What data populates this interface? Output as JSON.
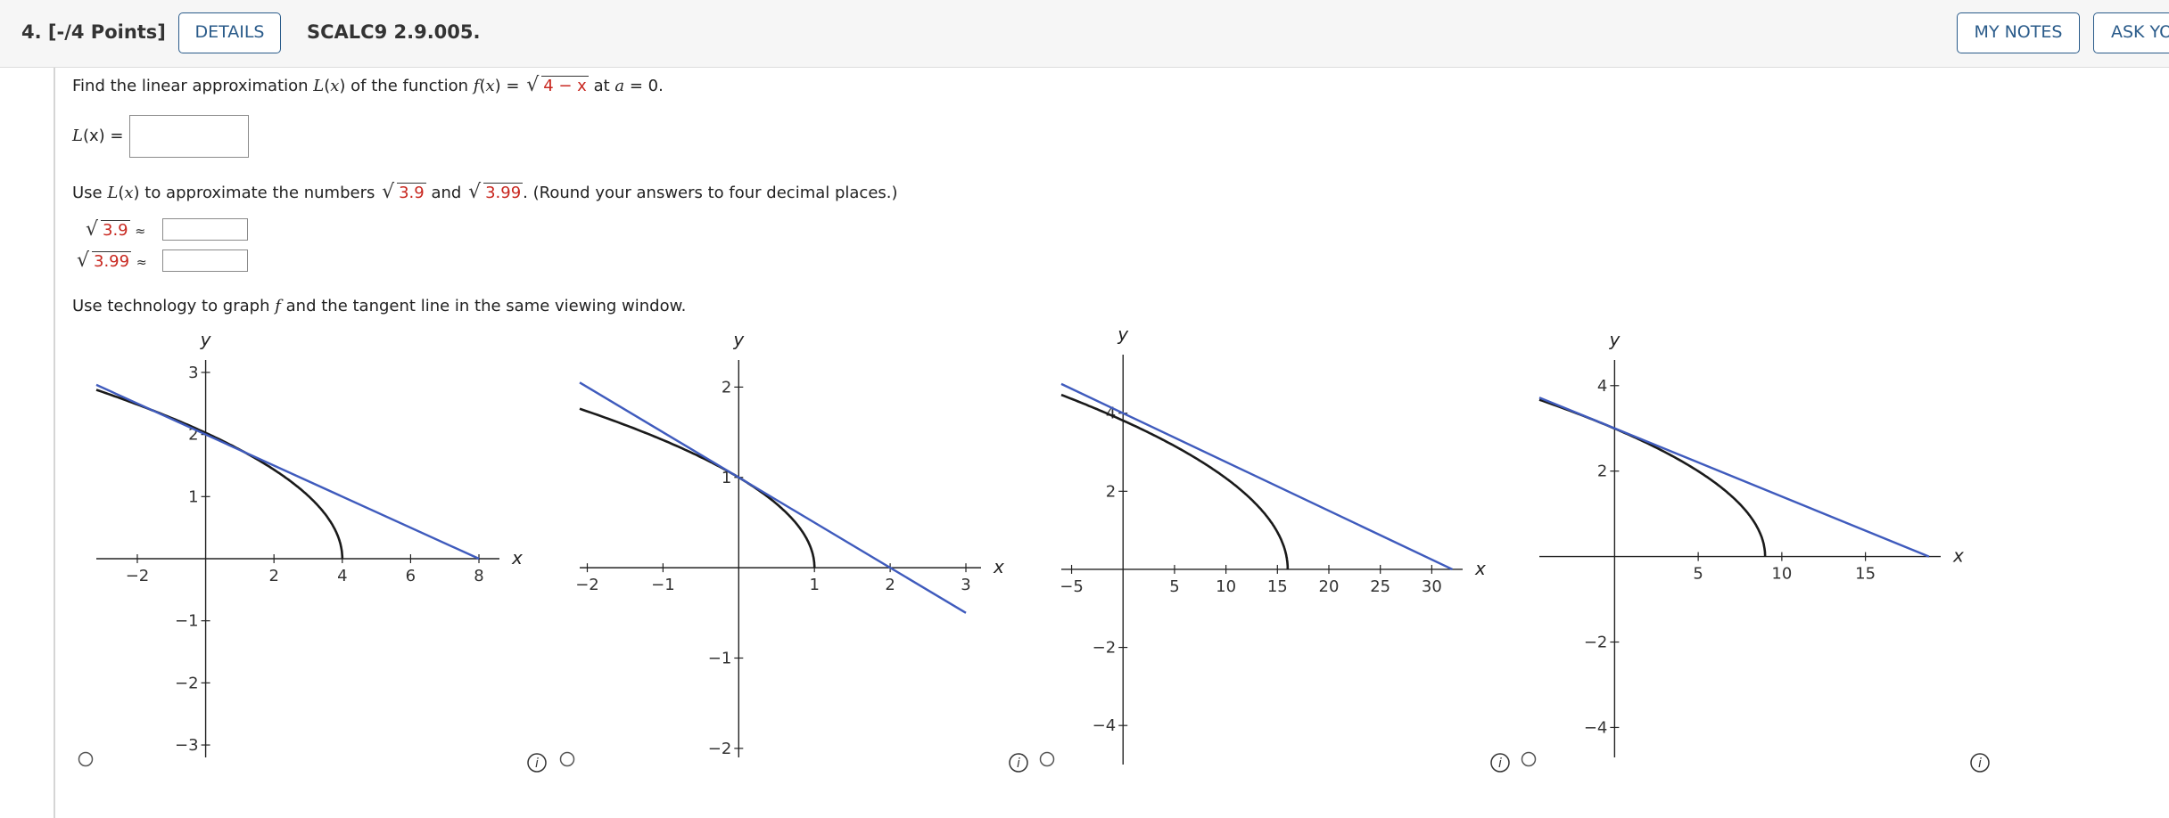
{
  "header": {
    "question_number": "4.  [-/4 Points]",
    "details_label": "DETAILS",
    "code": "SCALC9 2.9.005.",
    "my_notes_label": "MY NOTES",
    "ask_label": "ASK YO"
  },
  "problem": {
    "find_prefix": "Find the linear approximation",
    "L": "L",
    "x": "x",
    "find_mid": "of the function",
    "f": "f",
    "radicand_fx": "4 − x",
    "at_text": "at",
    "a": "a",
    "a_value": "= 0.",
    "Lx_label_L": "L",
    "Lx_label_rest": "(x) =",
    "use_prefix": "Use",
    "use_mid": "to approximate the numbers",
    "num1": "3.9",
    "and_text": "and",
    "num2": "3.99",
    "use_suffix": ". (Round your answers to four decimal places.)",
    "approx_symbol": "≈",
    "tech_prefix": "Use technology to graph",
    "tech_suffix": "and the tangent line in the same viewing window."
  },
  "colors": {
    "function_curve": "#1a1a1a",
    "tangent_line": "#3f5bbd",
    "radicand_number": "#c8271f",
    "button_border": "#2a5b8a"
  },
  "icons": [
    "radio-icon",
    "info-icon"
  ],
  "chart_data": [
    {
      "type": "line",
      "xlabel": "x",
      "ylabel": "y",
      "xlim": [
        -3.2,
        8.6
      ],
      "ylim": [
        -3.2,
        3.2
      ],
      "xticks": [
        "-2",
        "2",
        "4",
        "6",
        "8"
      ],
      "yticks": [
        "-3",
        "-2",
        "-1",
        "1",
        "2",
        "3"
      ],
      "series": [
        {
          "x": [
            -3.2,
            -2,
            0,
            2,
            3,
            3.8,
            4
          ],
          "y": [
            2.72,
            2.45,
            2.0,
            1.41,
            1.0,
            0.45,
            0.0
          ]
        },
        {
          "x": [
            -3.2,
            8
          ],
          "y": [
            2.8,
            0.0
          ]
        }
      ]
    },
    {
      "type": "line",
      "xlabel": "x",
      "ylabel": "y",
      "xlim": [
        -2.1,
        3.2
      ],
      "ylim": [
        -2.1,
        2.3
      ],
      "xticks": [
        "-2",
        "-1",
        "1",
        "2",
        "3"
      ],
      "yticks": [
        "-2",
        "-1",
        "1",
        "2"
      ],
      "series": [
        {
          "x": [
            -2.1,
            -1,
            0,
            0.5,
            0.9,
            1
          ],
          "y": [
            1.76,
            1.41,
            1.0,
            0.71,
            0.32,
            0.0
          ]
        },
        {
          "x": [
            -2.1,
            3
          ],
          "y": [
            2.05,
            -0.5
          ]
        }
      ]
    },
    {
      "type": "line",
      "xlabel": "x",
      "ylabel": "y",
      "xlim": [
        -6,
        33
      ],
      "ylim": [
        -5,
        5.5
      ],
      "xticks": [
        "-5",
        "5",
        "10",
        "15",
        "20",
        "25",
        "30"
      ],
      "yticks": [
        "-4",
        "-2",
        "2",
        "4"
      ],
      "series": [
        {
          "x": [
            -6,
            0,
            4,
            8,
            12,
            15,
            16
          ],
          "y": [
            4.47,
            4.0,
            3.46,
            2.83,
            2.0,
            1.0,
            0.0
          ]
        },
        {
          "x": [
            -6,
            32
          ],
          "y": [
            4.75,
            0.0
          ]
        }
      ]
    },
    {
      "type": "line",
      "xlabel": "x",
      "ylabel": "y",
      "xlim": [
        -4.5,
        19.5
      ],
      "ylim": [
        -4.7,
        4.6
      ],
      "xticks": [
        "5",
        "10",
        "15"
      ],
      "yticks": [
        "-4",
        "-2",
        "2",
        "4"
      ],
      "series": [
        {
          "x": [
            -4.5,
            0,
            3,
            6,
            8,
            9
          ],
          "y": [
            3.67,
            3.0,
            2.45,
            1.73,
            1.0,
            0.0
          ]
        },
        {
          "x": [
            -4.5,
            18.8
          ],
          "y": [
            3.72,
            0.0
          ]
        }
      ]
    }
  ]
}
